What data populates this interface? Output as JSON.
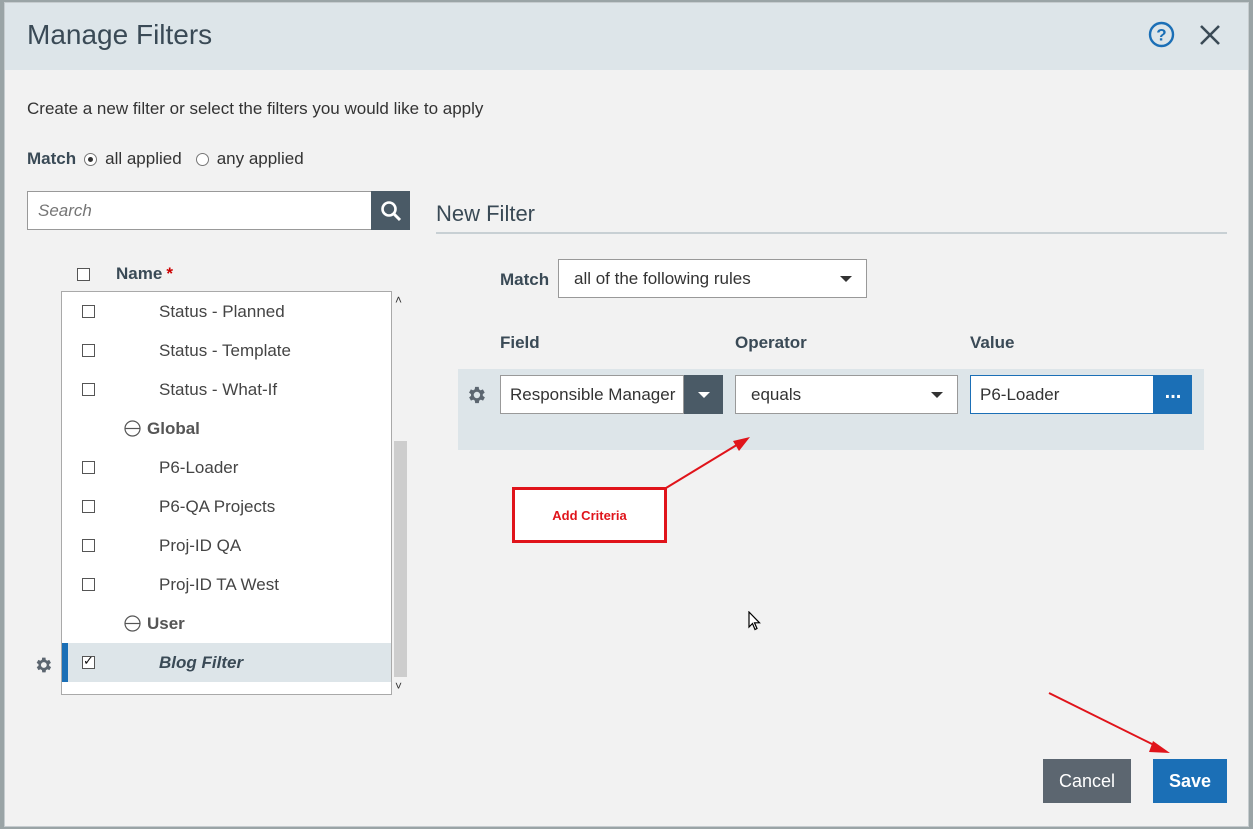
{
  "dialog": {
    "title": "Manage Filters",
    "help_icon": "help-circle-icon",
    "close_icon": "close-icon",
    "subtitle": "Create a new filter or select the filters you would like to apply"
  },
  "match": {
    "label": "Match",
    "options": [
      {
        "label": "all applied",
        "selected": true
      },
      {
        "label": "any applied",
        "selected": false
      }
    ]
  },
  "search": {
    "placeholder": "Search",
    "icon": "search-icon"
  },
  "list": {
    "header": "Name",
    "required_mark": "*",
    "items": [
      {
        "type": "item",
        "label": "Status - Planned",
        "checked": false
      },
      {
        "type": "item",
        "label": "Status - Template",
        "checked": false
      },
      {
        "type": "item",
        "label": "Status - What-If",
        "checked": false
      },
      {
        "type": "group",
        "label": "Global"
      },
      {
        "type": "item",
        "label": "P6-Loader",
        "checked": false
      },
      {
        "type": "item",
        "label": "P6-QA Projects",
        "checked": false
      },
      {
        "type": "item",
        "label": "Proj-ID QA",
        "checked": false
      },
      {
        "type": "item",
        "label": "Proj-ID TA West",
        "checked": false
      },
      {
        "type": "group",
        "label": "User"
      },
      {
        "type": "item",
        "label": "Blog Filter",
        "checked": true,
        "selected": true
      }
    ]
  },
  "new_filter": {
    "title": "New Filter",
    "match_label": "Match",
    "match_value": "all of the following rules",
    "columns": {
      "field": "Field",
      "operator": "Operator",
      "value": "Value"
    },
    "rule": {
      "field": "Responsible Manager",
      "operator": "equals",
      "value": "P6-Loader",
      "value_button": "..."
    }
  },
  "annotation": {
    "text": "Add Criteria",
    "color": "#e0141b"
  },
  "buttons": {
    "cancel": "Cancel",
    "save": "Save"
  },
  "colors": {
    "accent": "#1b6fb6",
    "header_bg": "#dde5e9",
    "dark_button": "#4a5a66"
  }
}
